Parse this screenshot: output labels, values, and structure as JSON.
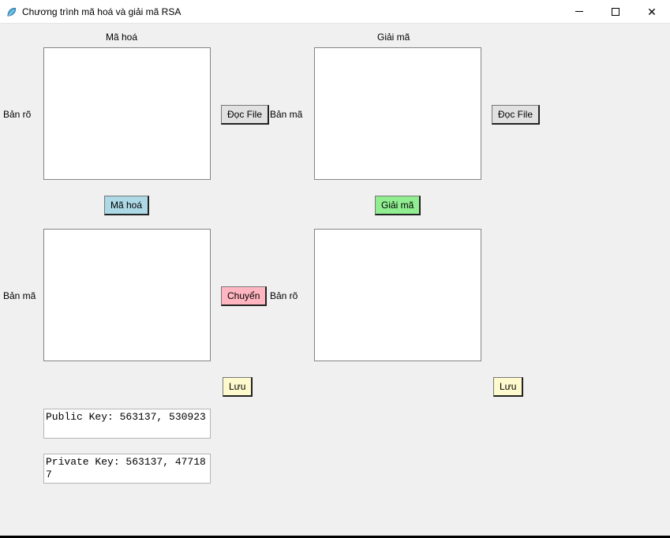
{
  "window": {
    "title": "Chương trình mã hoá và giải mã RSA"
  },
  "headings": {
    "encrypt": "Mã hoá",
    "decrypt": "Giải mã"
  },
  "labels": {
    "plaintext": "Bản rõ",
    "ciphertext": "Bản mã"
  },
  "buttons": {
    "read_file": "Đọc File",
    "encrypt": "Mã hoá",
    "decrypt": "Giải mã",
    "transfer": "Chuyển",
    "save": "Lưu"
  },
  "fields": {
    "encrypt_input": "",
    "encrypt_output": "",
    "decrypt_input": "",
    "decrypt_output": ""
  },
  "keys": {
    "public": "Public Key: 563137, 530923",
    "private": "Private Key: 563137, 477187"
  }
}
